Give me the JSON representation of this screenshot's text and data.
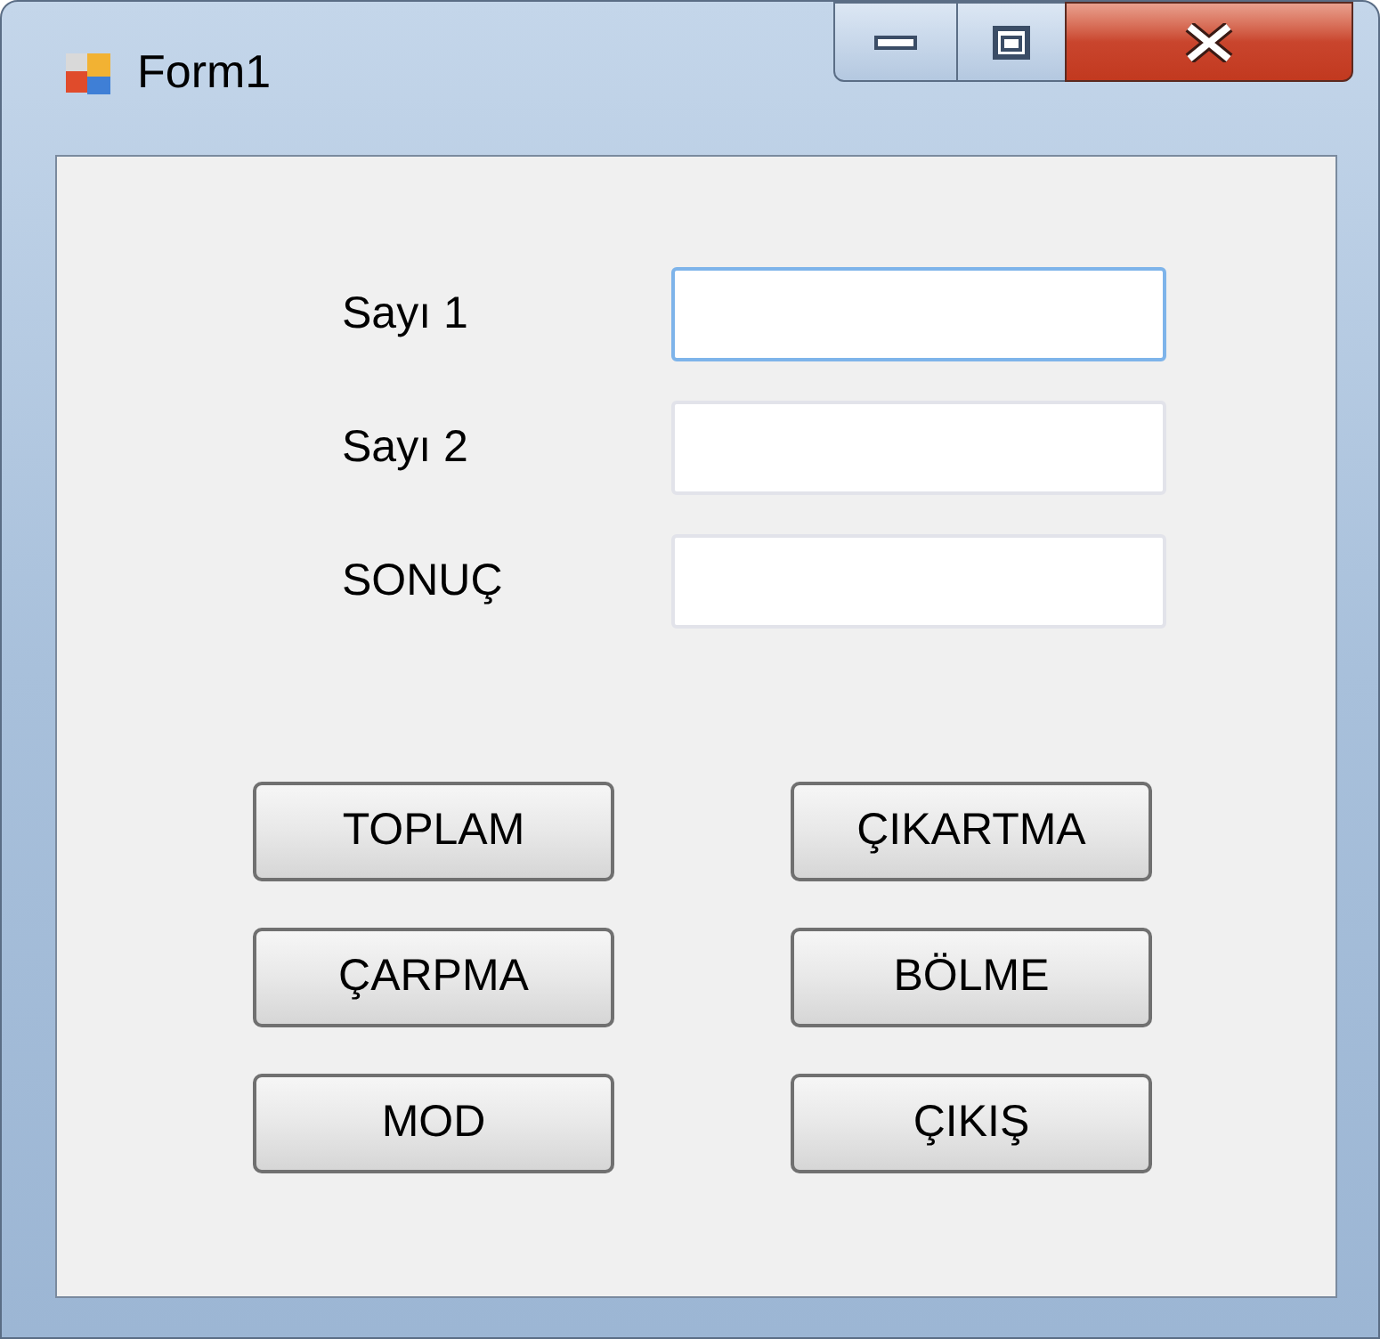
{
  "window": {
    "title": "Form1"
  },
  "fields": [
    {
      "label": "Sayı 1",
      "focused": true
    },
    {
      "label": "Sayı 2",
      "focused": false
    },
    {
      "label": "SONUÇ",
      "focused": false
    }
  ],
  "buttons": [
    {
      "label": "TOPLAM"
    },
    {
      "label": "ÇIKARTMA"
    },
    {
      "label": "ÇARPMA"
    },
    {
      "label": "BÖLME"
    },
    {
      "label": "MOD"
    },
    {
      "label": "ÇIKIŞ"
    }
  ]
}
